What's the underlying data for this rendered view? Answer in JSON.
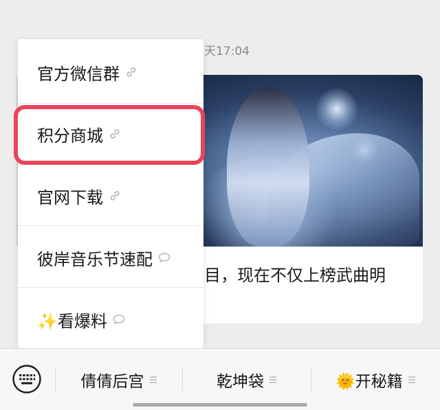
{
  "chat": {
    "timestamp": "天17:04",
    "article": {
      "title": "目，现在不仅上榜武曲明"
    }
  },
  "popup_menu": {
    "items": [
      {
        "label": "官方微信群",
        "icon": "link-icon"
      },
      {
        "label": "积分商城",
        "icon": "link-icon",
        "highlighted": true
      },
      {
        "label": "官网下载",
        "icon": "link-icon"
      },
      {
        "label": "彼岸音乐节速配",
        "icon": "chat-bubble-icon"
      },
      {
        "label": "✨看爆料",
        "icon": "chat-bubble-icon"
      }
    ],
    "highlight_color": "#e8455a"
  },
  "bottom_menu": {
    "keyboard_icon": "keyboard-icon",
    "items": [
      {
        "label": "倩倩后宫",
        "icon": "menu-lines-icon"
      },
      {
        "label": "乾坤袋",
        "icon": "menu-lines-icon"
      },
      {
        "label": "🌞开秘籍",
        "icon": "menu-lines-icon"
      }
    ]
  }
}
